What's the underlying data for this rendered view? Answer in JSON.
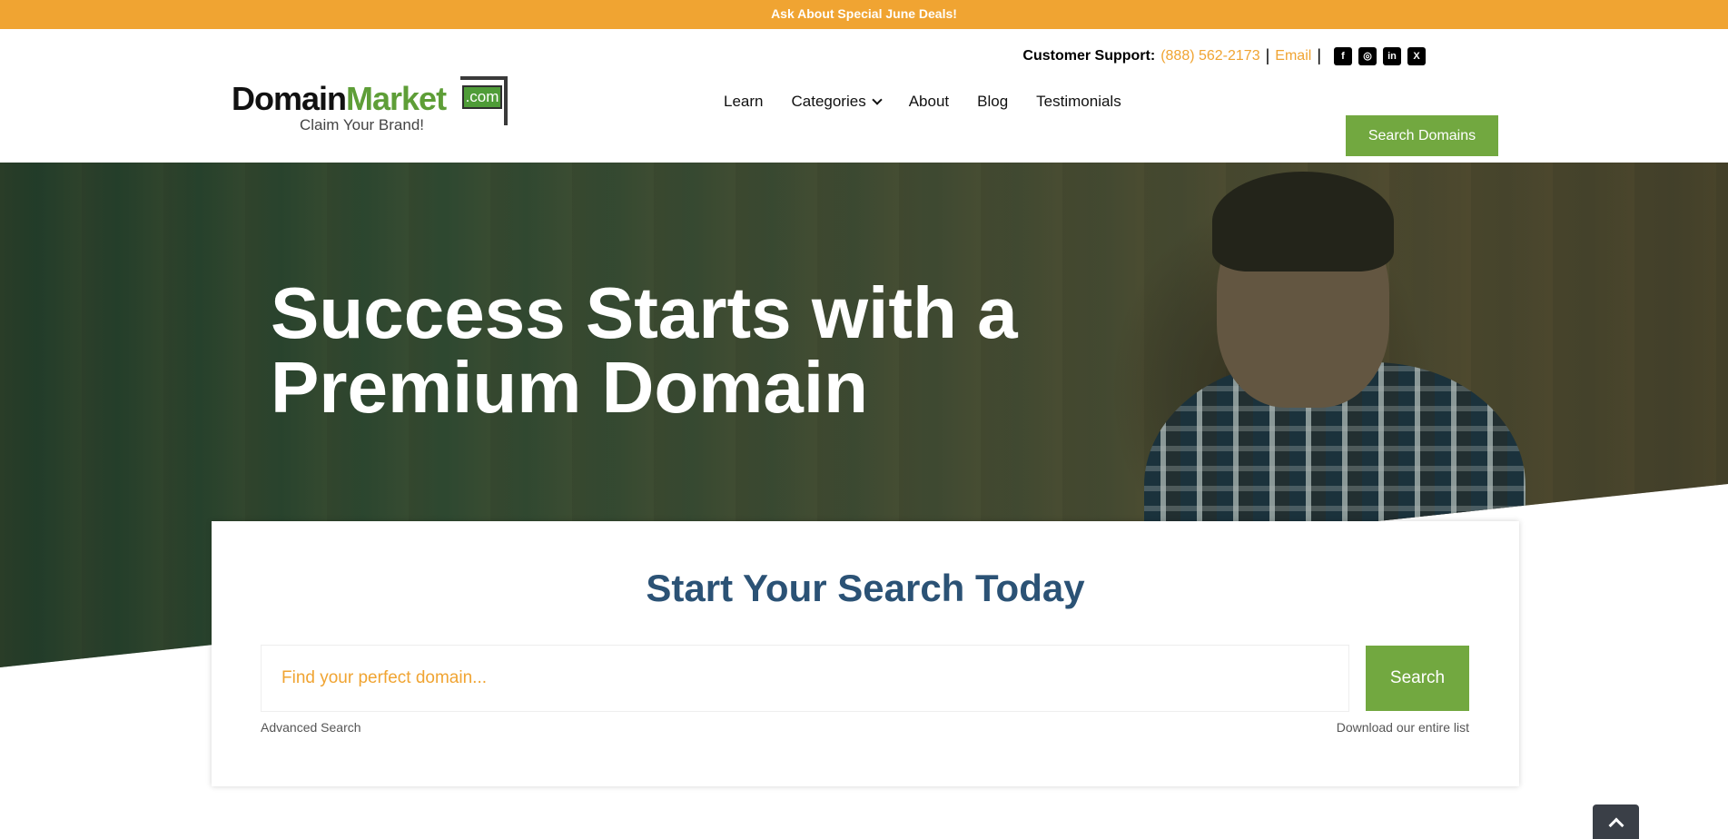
{
  "promo": {
    "text": "Ask About Special June Deals!"
  },
  "support": {
    "label": "Customer Support:",
    "phone": "(888) 562-2173",
    "email": "Email",
    "separator": "|",
    "social": [
      {
        "name": "facebook-icon",
        "glyph": "f"
      },
      {
        "name": "instagram-icon",
        "glyph": "◎"
      },
      {
        "name": "linkedin-icon",
        "glyph": "in"
      },
      {
        "name": "x-icon",
        "glyph": "X"
      }
    ]
  },
  "logo": {
    "domain": "Domain",
    "market": "Market",
    "com": ".com",
    "tagline": "Claim Your Brand!"
  },
  "nav": {
    "learn": "Learn",
    "categories": "Categories",
    "about": "About",
    "blog": "Blog",
    "testimonials": "Testimonials"
  },
  "cta": {
    "label": "Search Domains"
  },
  "hero": {
    "title_line1": "Success Starts with a",
    "title_line2": "Premium Domain"
  },
  "search": {
    "heading": "Start Your Search Today",
    "placeholder": "Find your perfect domain...",
    "button": "Search",
    "advanced": "Advanced Search",
    "download": "Download our entire list"
  },
  "colors": {
    "accent": "#f0a432",
    "brand_green": "#72a840",
    "heading_blue": "#2b5275"
  }
}
